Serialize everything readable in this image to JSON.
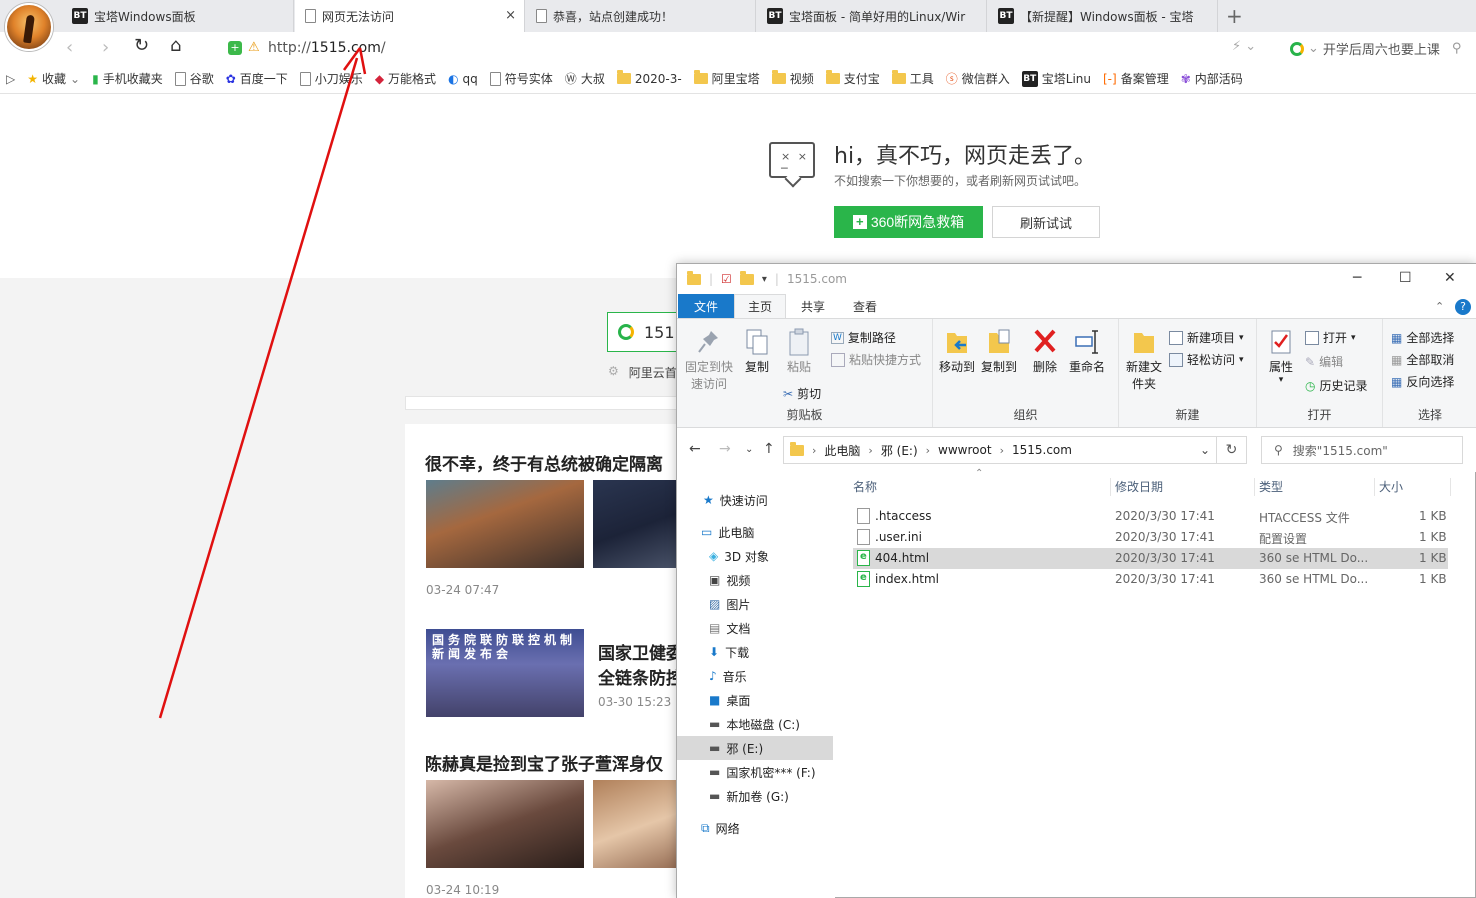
{
  "browser": {
    "tabs": [
      {
        "label": "宝塔Windows面板",
        "badge": "BT"
      },
      {
        "label": "网页无法访问",
        "active": true
      },
      {
        "label": "恭喜，站点创建成功！"
      },
      {
        "label": "宝塔面板 - 简单好用的Linux/Wir",
        "badge": "BT"
      },
      {
        "label": "【新提醒】Windows面板 - 宝塔",
        "badge": "BT"
      }
    ],
    "close_glyph": "×",
    "newtab_glyph": "+",
    "url": {
      "prefix": "http://",
      "host": "1515.com",
      "suffix": "/"
    },
    "right_hint": "开学后周六也要上课",
    "bookmarks": [
      {
        "label": "收藏",
        "icon": "star-icon"
      },
      {
        "label": "手机收藏夹",
        "icon": "phone-icon"
      },
      {
        "label": "谷歌",
        "icon": "page-icon"
      },
      {
        "label": "百度一下",
        "icon": "baidu-paw-icon"
      },
      {
        "label": "小刀娱乐",
        "icon": "page-icon"
      },
      {
        "label": "万能格式",
        "icon": "cube-icon"
      },
      {
        "label": "qq",
        "icon": "qq-icon"
      },
      {
        "label": "符号实体",
        "icon": "page-icon"
      },
      {
        "label": "大叔",
        "icon": "wordpress-icon"
      },
      {
        "label": "2020-3-",
        "icon": "folder-icon"
      },
      {
        "label": "阿里宝塔",
        "icon": "folder-icon"
      },
      {
        "label": "视频",
        "icon": "folder-icon"
      },
      {
        "label": "支付宝",
        "icon": "folder-icon"
      },
      {
        "label": "工具",
        "icon": "folder-icon"
      },
      {
        "label": "微信群入",
        "icon": "weibo-icon"
      },
      {
        "label": "宝塔Linu",
        "icon": "bt-icon"
      },
      {
        "label": "备案管理",
        "icon": "aliyun-icon"
      },
      {
        "label": "内部活码",
        "icon": "flower-icon"
      }
    ]
  },
  "error_page": {
    "title": "hi，真不巧，网页走丢了。",
    "subtitle": "不如搜索一下你想要的，或者刷新网页试试吧。",
    "rescue_button": "360断网急救箱",
    "refresh_button": "刷新试试",
    "search_value": "151",
    "search_note": "阿里云首"
  },
  "news": [
    {
      "headline": "很不幸，终于有总统被确定隔离",
      "date": "03-24 07:47"
    },
    {
      "headline": "国家卫健委",
      "headline2": "全链条防控",
      "date": "03-30 15:23",
      "thumb_caption": "国务院联防联控机制新闻发布会"
    },
    {
      "headline": "陈赫真是捡到宝了张子萱浑身仅",
      "date": "03-24 10:19"
    }
  ],
  "explorer": {
    "title": "1515.com",
    "ribbon_tabs": [
      "文件",
      "主页",
      "共享",
      "查看"
    ],
    "clipboard": {
      "pin": "固定到快速访问",
      "copy": "复制",
      "paste": "粘贴",
      "copy_path": "复制路径",
      "paste_shortcut": "粘贴快捷方式",
      "cut": "剪切",
      "label": "剪贴板"
    },
    "organize": {
      "move": "移动到",
      "copy_to": "复制到",
      "delete": "删除",
      "rename": "重命名",
      "label": "组织"
    },
    "new": {
      "folder": "新建文件夹",
      "item": "新建项目",
      "easy": "轻松访问",
      "label": "新建"
    },
    "open": {
      "props": "属性",
      "open": "打开",
      "edit": "编辑",
      "history": "历史记录",
      "label": "打开"
    },
    "select": {
      "all": "全部选择",
      "none": "全部取消",
      "invert": "反向选择",
      "label": "选择"
    },
    "path": [
      "此电脑",
      "邪 (E:)",
      "wwwroot",
      "1515.com"
    ],
    "search_placeholder": "搜索\"1515.com\"",
    "sidebar": [
      {
        "label": "快速访问",
        "icon": "star-icon"
      },
      {
        "label": "此电脑",
        "icon": "pc-icon"
      },
      {
        "label": "3D 对象",
        "icon": "cube3d-icon"
      },
      {
        "label": "视频",
        "icon": "video-icon"
      },
      {
        "label": "图片",
        "icon": "picture-icon"
      },
      {
        "label": "文档",
        "icon": "doc-icon"
      },
      {
        "label": "下载",
        "icon": "download-icon"
      },
      {
        "label": "音乐",
        "icon": "music-icon"
      },
      {
        "label": "桌面",
        "icon": "desktop-icon"
      },
      {
        "label": "本地磁盘 (C:)",
        "icon": "disk-c-icon"
      },
      {
        "label": "邪 (E:)",
        "icon": "disk-icon",
        "selected": true
      },
      {
        "label": "国家机密*** (F:)",
        "icon": "disk-icon"
      },
      {
        "label": "新加卷 (G:)",
        "icon": "disk-icon"
      },
      {
        "label": "网络",
        "icon": "network-icon"
      }
    ],
    "columns": [
      "名称",
      "修改日期",
      "类型",
      "大小"
    ],
    "files": [
      {
        "name": ".htaccess",
        "date": "2020/3/30 17:41",
        "type": "HTACCESS 文件",
        "size": "1 KB",
        "kind": "plain"
      },
      {
        "name": ".user.ini",
        "date": "2020/3/30 17:41",
        "type": "配置设置",
        "size": "1 KB",
        "kind": "ini"
      },
      {
        "name": "404.html",
        "date": "2020/3/30 17:41",
        "type": "360 se HTML Do...",
        "size": "1 KB",
        "kind": "html",
        "selected": true
      },
      {
        "name": "index.html",
        "date": "2020/3/30 17:41",
        "type": "360 se HTML Do...",
        "size": "1 KB",
        "kind": "html"
      }
    ]
  },
  "colors": {
    "accent_green": "#2ab54a",
    "arrow_red": "#e01010",
    "ribbon_blue": "#1979ca"
  }
}
